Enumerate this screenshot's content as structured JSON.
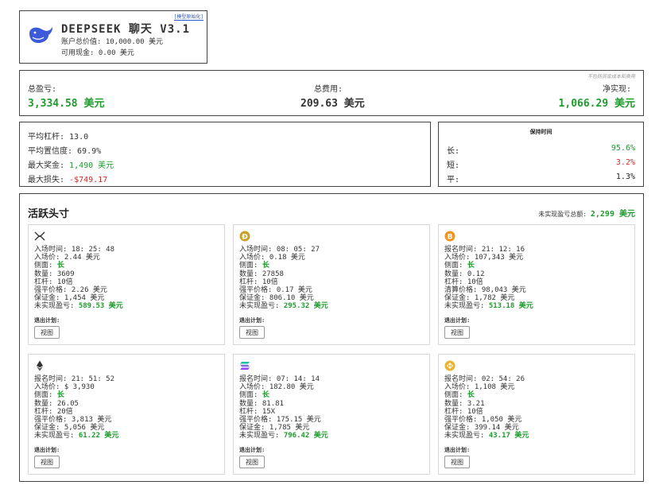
{
  "header": {
    "title": "DEEPSEEK 聊天 V3.1",
    "account_value": "账户总价值: 10,000.00 美元",
    "cash": "可用现金: 0.00 美元",
    "tag": "[模型原始化]",
    "logo_icon": "deepseek-whale-icon"
  },
  "pnl": {
    "note": "不包括资金成本和费用",
    "total_label": "总盈亏:",
    "total_value": "3,334.58 美元",
    "fees_label": "总费用:",
    "fees_value": "209.63 美元",
    "net_label": "净实现:",
    "net_value": "1,066.29 美元"
  },
  "stats": {
    "leverage": "平均杠杆: 13.0",
    "confidence": "平均置信度: 69.9%",
    "max_win_label": "最大奖金: ",
    "max_win_value": "1,490 美元",
    "max_loss_label": "最大损失: ",
    "max_loss_value": "-$749.17"
  },
  "hold": {
    "title": "保持时间",
    "long_label": "长:",
    "long_value": "95.6%",
    "short_label": "短:",
    "short_value": "3.2%",
    "flat_label": "平:",
    "flat_value": "1.3%"
  },
  "positions": {
    "title": "活跃头寸",
    "unrealized_label": "未实现盈亏总额: ",
    "unrealized_value": "2,299 美元",
    "plan_label": "退出计划:",
    "view_label": "视图",
    "cards": [
      {
        "icon": "xrp-icon",
        "l1": "入场时间: 18: 25: 48",
        "l2": "入场价: 2.44 美元",
        "side_label": "侧面: ",
        "side_value": "长",
        "l4": "数量: 3609",
        "l5": "杠杆: 10倍",
        "l6": "强平价格: 2.26 美元",
        "l7": "保证金: 1,454 美元",
        "pnl_label": "未实现盈亏: ",
        "pnl_value": "589.53 美元"
      },
      {
        "icon": "dogecoin-icon",
        "l1": "入场时间: 08: 05: 27",
        "l2": "入场价: 0.18 美元",
        "side_label": "侧面: ",
        "side_value": "长",
        "l4": "数量: 27858",
        "l5": "杠杆: 10倍",
        "l6": "强平价格: 0.17 美元",
        "l7": "保证金: 806.10 美元",
        "pnl_label": "未实现盈亏: ",
        "pnl_value": "295.32 美元"
      },
      {
        "icon": "bitcoin-icon",
        "l1": "报名时间: 21: 12: 16",
        "l2": "入场价: 107,343 美元",
        "side_label": "侧面: ",
        "side_value": "长",
        "l4": "数量: 0.12",
        "l5": "杠杆: 10倍",
        "l6": "清算价格: 98,043 美元",
        "l7": "保证金: 1,782 美元",
        "pnl_label": "未实现盈亏: ",
        "pnl_value": "513.18 美元"
      },
      {
        "icon": "ethereum-icon",
        "l1": "报名时间: 21: 51: 52",
        "l2": "入场价: $ 3,930",
        "side_label": "侧面: ",
        "side_value": "长",
        "l4": "数量: 26.05",
        "l5": "杠杆: 20倍",
        "l6": "强平价格: 3,813 美元",
        "l7": "保证金: 5,056 美元",
        "pnl_label": "未实现盈亏: ",
        "pnl_value": "61.22 美元"
      },
      {
        "icon": "solana-icon",
        "l1": "报名时间: 07: 14: 14",
        "l2": "入场价: 182.80 美元",
        "side_label": "侧面: ",
        "side_value": "长",
        "l4": "数量: 81.81",
        "l5": "杠杆: 15X",
        "l6": "强平价格: 175.15 美元",
        "l7": "保证金: 1,785 美元",
        "pnl_label": "未实现盈亏: ",
        "pnl_value": "796.42 美元"
      },
      {
        "icon": "bnb-icon",
        "l1": "报名时间: 02: 54: 26",
        "l2": "入场价: 1,108 美元",
        "side_label": "侧面: ",
        "side_value": "长",
        "l4": "数量: 3.21",
        "l5": "杠杆: 10倍",
        "l6": "强平价格: 1,050 美元",
        "l7": "保证金: 399.14 美元",
        "pnl_label": "未实现盈亏: ",
        "pnl_value": "43.17 美元"
      }
    ]
  }
}
